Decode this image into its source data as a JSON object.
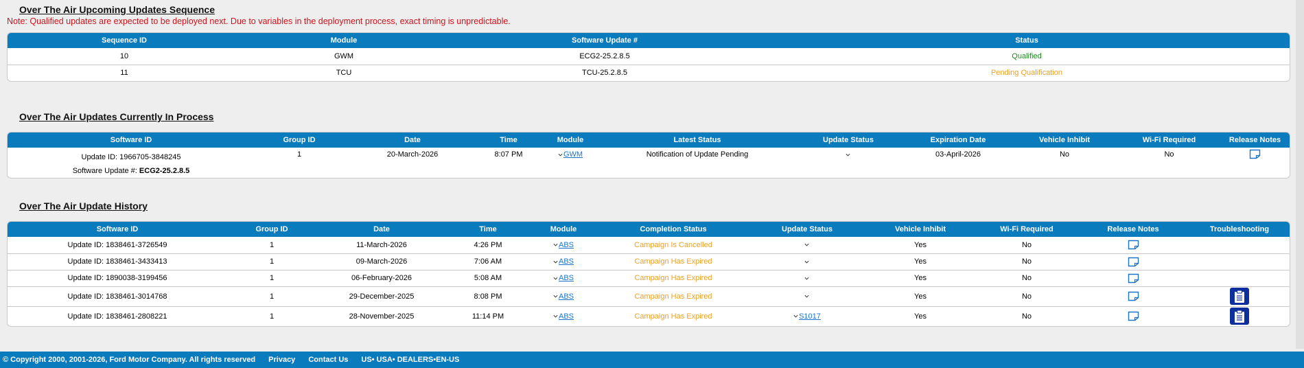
{
  "upcoming": {
    "title": "Over The Air Upcoming Updates Sequence",
    "note": "Note: Qualified updates are expected to be deployed next. Due to variables in the deployment process, exact timing is unpredictable.",
    "headers": [
      "Sequence ID",
      "Module",
      "Software Update #",
      "Status"
    ],
    "rows": [
      {
        "seq": "10",
        "module": "GWM",
        "update": "ECG2-25.2.8.5",
        "status": "Qualified"
      },
      {
        "seq": "11",
        "module": "TCU",
        "update": "TCU-25.2.8.5",
        "status": "Pending Qualification"
      }
    ]
  },
  "in_process": {
    "title": "Over The Air Updates Currently In Process",
    "headers": [
      "Software ID",
      "Group ID",
      "Date",
      "Time",
      "Module",
      "Latest Status",
      "Update Status",
      "Expiration Date",
      "Vehicle Inhibit",
      "Wi-Fi Required",
      "Release Notes"
    ],
    "row": {
      "software_id": "Update ID: 1966705-3848245",
      "software_update_label": "Software Update #:",
      "software_update_value": "ECG2-25.2.8.5",
      "group": "1",
      "date": "20-March-2026",
      "time": "8:07 PM",
      "module": "GWM",
      "latest_status": "Notification of Update Pending",
      "expiration": "03-April-2026",
      "inhibit": "No",
      "wifi": "No"
    }
  },
  "history": {
    "title": "Over The Air Update History",
    "headers": [
      "Software ID",
      "Group ID",
      "Date",
      "Time",
      "Module",
      "Completion Status",
      "Update Status",
      "Vehicle Inhibit",
      "Wi-Fi Required",
      "Release Notes",
      "Troubleshooting"
    ],
    "rows": [
      {
        "software_id": "Update ID: 1838461-3726549",
        "group": "1",
        "date": "11-March-2026",
        "time": "4:26 PM",
        "module": "ABS",
        "completion": "Campaign Is Cancelled",
        "update_status": "",
        "inhibit": "Yes",
        "wifi": "No"
      },
      {
        "software_id": "Update ID: 1838461-3433413",
        "group": "1",
        "date": "09-March-2026",
        "time": "7:06 AM",
        "module": "ABS",
        "completion": "Campaign Has Expired",
        "update_status": "",
        "inhibit": "Yes",
        "wifi": "No"
      },
      {
        "software_id": "Update ID: 1890038-3199456",
        "group": "1",
        "date": "06-February-2026",
        "time": "5:08 AM",
        "module": "ABS",
        "completion": "Campaign Has Expired",
        "update_status": "",
        "inhibit": "Yes",
        "wifi": "No"
      },
      {
        "software_id": "Update ID: 1838461-3014768",
        "group": "1",
        "date": "29-December-2025",
        "time": "8:08 PM",
        "module": "ABS",
        "completion": "Campaign Has Expired",
        "update_status": "",
        "inhibit": "Yes",
        "wifi": "No"
      },
      {
        "software_id": "Update ID: 1838461-2808221",
        "group": "1",
        "date": "28-November-2025",
        "time": "11:14 PM",
        "module": "ABS",
        "completion": "Campaign Has Expired",
        "update_status": "S1017",
        "inhibit": "Yes",
        "wifi": "No"
      }
    ]
  },
  "footer": {
    "copyright": "© Copyright 2000, 2001-2026, Ford Motor Company. All rights reserved",
    "privacy": "Privacy",
    "contact": "Contact Us",
    "locale": "US• USA• DEALERS•EN-US"
  },
  "colors": {
    "header_blue": "#0a7bbd",
    "qualified": "#1b8a1b",
    "pending": "#f0a020",
    "note_red": "#d0121b",
    "troubleshoot_blue": "#0d2f9e"
  },
  "icons": [
    "caret-down-icon",
    "release-notes-icon",
    "clipboard-icon"
  ]
}
